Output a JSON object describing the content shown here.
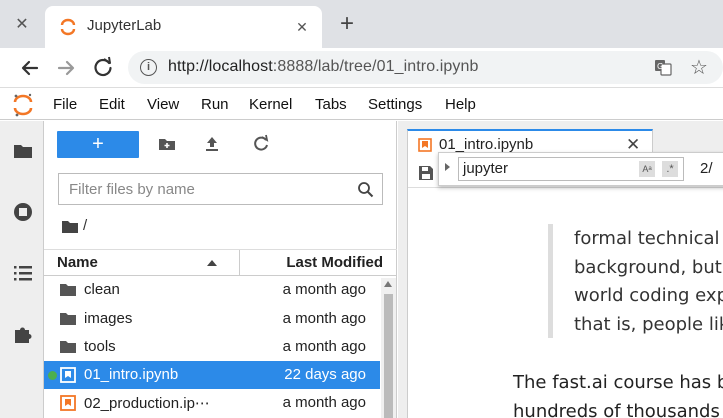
{
  "browser": {
    "tab_title": "JupyterLab",
    "url_host": "http://localhost",
    "url_rest": ":8888/lab/tree/01_intro.ipynb"
  },
  "menu": [
    "File",
    "Edit",
    "View",
    "Run",
    "Kernel",
    "Tabs",
    "Settings",
    "Help"
  ],
  "filebrowser": {
    "new_label": "+",
    "filter_placeholder": "Filter files by name",
    "breadcrumb": "/",
    "col_name": "Name",
    "col_modified": "Last Modified",
    "rows": [
      {
        "name": "clean",
        "modified": "a month ago",
        "type": "folder"
      },
      {
        "name": "images",
        "modified": "a month ago",
        "type": "folder"
      },
      {
        "name": "tools",
        "modified": "a month ago",
        "type": "folder"
      },
      {
        "name": "01_intro.ipynb",
        "modified": "22 days ago",
        "type": "notebook"
      },
      {
        "name": "02_production.ip⋯",
        "modified": "a month ago",
        "type": "notebook"
      }
    ]
  },
  "notebook": {
    "tab_title": "01_intro.ipynb",
    "find_query": "jupyter",
    "find_case_label": "Aᵃ",
    "find_regex_label": ".*",
    "find_count": "2/",
    "quote_lines": [
      "formal technical",
      "background, but l",
      "world coding expe",
      "that is, people like"
    ],
    "para_lines": [
      "The fast.ai course has bee",
      "hundreds of thousands o"
    ]
  },
  "colors": {
    "accent": "#2c8ae8",
    "jupyter_orange": "#f37726",
    "running": "#4caf50"
  }
}
